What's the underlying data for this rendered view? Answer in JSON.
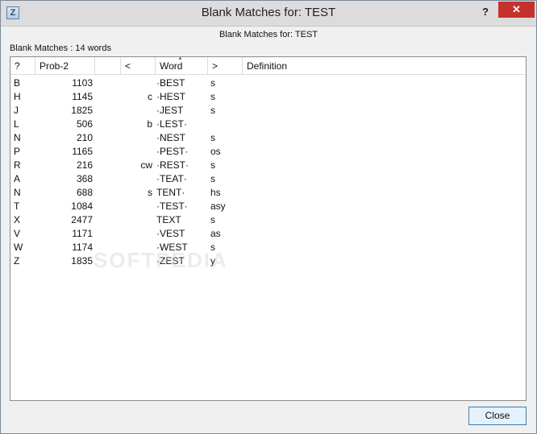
{
  "window": {
    "title": "Blank Matches for: TEST",
    "icon_letter": "Z",
    "help_label": "?",
    "close_label": "✕"
  },
  "header_label": "Blank Matches for: TEST",
  "count": {
    "prefix": "Blank Matches :",
    "value": "14 words"
  },
  "columns": [
    "?",
    "Prob-2",
    "",
    "<",
    "Word",
    ">",
    "Definition"
  ],
  "rows": [
    {
      "q": "B",
      "prob": "1103",
      "lt": "",
      "word": "·BEST",
      "gt": "s",
      "def": ""
    },
    {
      "q": "H",
      "prob": "1145",
      "lt": "c",
      "word": "·HEST",
      "gt": "s",
      "def": ""
    },
    {
      "q": "J",
      "prob": "1825",
      "lt": "",
      "word": "·JEST",
      "gt": "s",
      "def": ""
    },
    {
      "q": "L",
      "prob": "506",
      "lt": "b",
      "word": "·LEST·",
      "gt": "",
      "def": ""
    },
    {
      "q": "N",
      "prob": "210",
      "lt": "",
      "word": "·NEST",
      "gt": "s",
      "def": ""
    },
    {
      "q": "P",
      "prob": "1165",
      "lt": "",
      "word": "·PEST·",
      "gt": "os",
      "def": ""
    },
    {
      "q": "R",
      "prob": "216",
      "lt": "cw",
      "word": "·REST·",
      "gt": "s",
      "def": ""
    },
    {
      "q": "A",
      "prob": "368",
      "lt": "",
      "word": "·TEAT·",
      "gt": "s",
      "def": ""
    },
    {
      "q": "N",
      "prob": "688",
      "lt": "s",
      "word": "TENT·",
      "gt": "hs",
      "def": ""
    },
    {
      "q": "T",
      "prob": "1084",
      "lt": "",
      "word": "·TEST·",
      "gt": "asy",
      "def": ""
    },
    {
      "q": "X",
      "prob": "2477",
      "lt": "",
      "word": "TEXT",
      "gt": "s",
      "def": ""
    },
    {
      "q": "V",
      "prob": "1171",
      "lt": "",
      "word": "·VEST",
      "gt": "as",
      "def": ""
    },
    {
      "q": "W",
      "prob": "1174",
      "lt": "",
      "word": "·WEST",
      "gt": "s",
      "def": ""
    },
    {
      "q": "Z",
      "prob": "1835",
      "lt": "",
      "word": "·ZEST",
      "gt": "y",
      "def": ""
    }
  ],
  "watermark": "SOFTPEDIA",
  "close_button_label": "Close"
}
